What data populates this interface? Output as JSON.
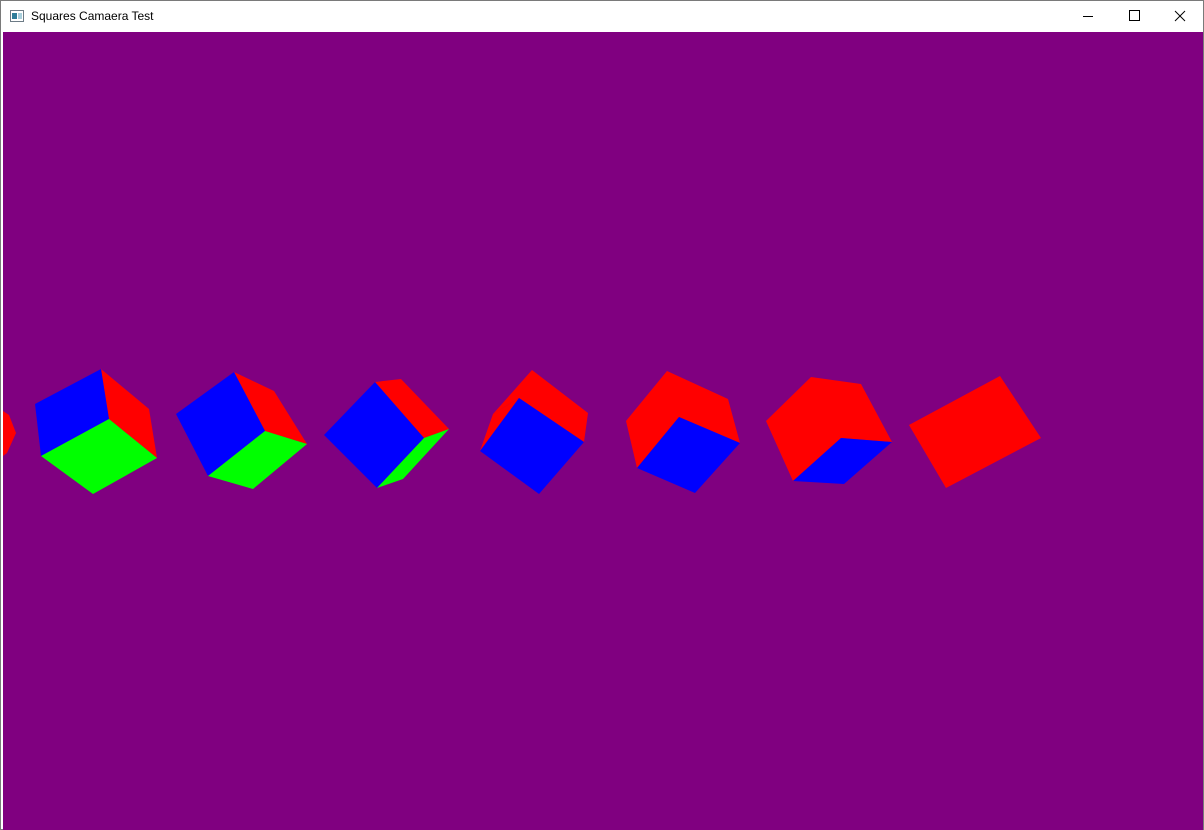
{
  "window": {
    "title": "Squares Camaera Test",
    "controls": [
      "minimize-icon",
      "maximize-icon",
      "close-icon"
    ]
  },
  "scene": {
    "background_color": "#800080",
    "face_colors": {
      "red": "#ff0000",
      "blue": "#0000ff",
      "green": "#00ff00"
    },
    "cube_count": 8
  }
}
